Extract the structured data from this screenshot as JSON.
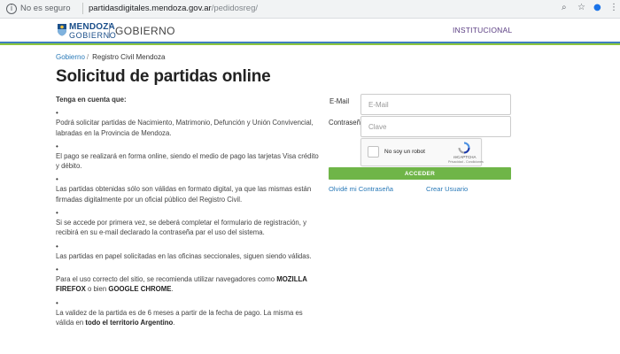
{
  "browser": {
    "security_text": "No es seguro",
    "url_host": "partidasdigitales.mendoza.gov.ar",
    "url_path": "/pedidosreg/"
  },
  "header": {
    "logo_line1": "MENDOZA",
    "logo_line2": "GOBIERNO",
    "section_title": "GOBIERNO",
    "nav_link": "INSTITUCIONAL"
  },
  "breadcrumb": {
    "home": "Gobierno",
    "separator": "/",
    "current": "Registro Civil Mendoza"
  },
  "page_title": "Solicitud de partidas online",
  "info": {
    "heading": "Tenga en cuenta que:",
    "bullet": "•",
    "item1": "Podrá solicitar partidas de Nacimiento, Matrimonio, Defunción y Unión Convivencial, labradas en la Provincia de Mendoza.",
    "item2": "El pago se realizará en forma online, siendo el medio de pago las tarjetas Visa crédito y débito.",
    "item3": "Las partidas obtenidas sólo son válidas en formato digital, ya que las mismas están firmadas digitalmente por un oficial público del Registro Civil.",
    "item4": "Si se accede por primera vez, se deberá completar el formulario de registración, y recibirá en su e-mail declarado la contraseña par el uso del sistema.",
    "item5": "Las partidas en papel solicitadas en las oficinas seccionales, siguen siendo válidas.",
    "item6_pre": "Para el uso correcto del sitio, se recomienda utilizar navegadores como ",
    "item6_b1": "MOZILLA FIREFOX",
    "item6_mid": " o bien ",
    "item6_b2": "GOOGLE CHROME",
    "item6_post": ".",
    "item7_pre": "La validez de la partida es de 6 meses a partir de la fecha de pago. La misma es válida en ",
    "item7_b": "todo el territorio Argentino",
    "item7_post": "."
  },
  "login": {
    "email_label": "E-Mail",
    "email_placeholder": "E-Mail",
    "email_value": "",
    "password_label": "Contraseña",
    "password_placeholder": "Clave",
    "password_value": "",
    "captcha_text": "No soy un robot",
    "captcha_brand": "reCAPTCHA",
    "captcha_terms": "Privacidad - Condiciones",
    "submit_label": "ACCEDER",
    "forgot_link": "Olvidé mi Contraseña",
    "register_link": "Crear Usuario"
  },
  "icons": {
    "security": "info-circle-icon",
    "zoom": "magnifier-icon",
    "bookmark": "star-icon",
    "extension": "person-icon",
    "menu": "kebab-menu-icon"
  },
  "colors": {
    "brand_blue": "#1b4f8a",
    "stripe_blue": "#3f7fbf",
    "stripe_green": "#8cc63e",
    "link": "#2a7ab8",
    "button": "#6fb548",
    "nav": "#5a3d82"
  }
}
